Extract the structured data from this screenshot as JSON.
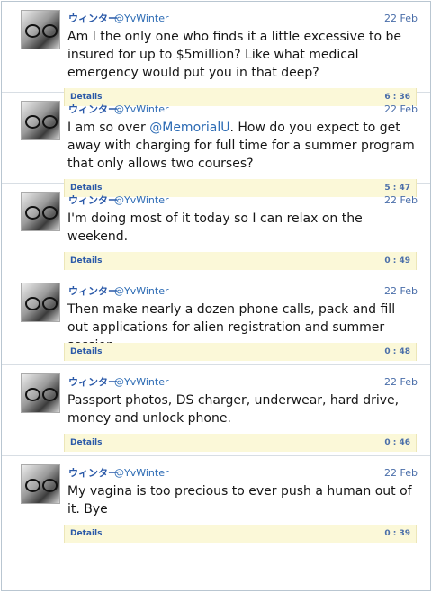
{
  "tweets": [
    {
      "name": "ウィンター",
      "handle": "@YvWinter",
      "date": "22 Feb",
      "text": "Am I the only one who finds it a little excessive to be insured for up to $5million? Like what medical emergency would put you in that deep?",
      "details_label": "Details",
      "time": "6 : 36"
    },
    {
      "name": "ウィンター",
      "handle": "@YvWinter",
      "date": "22 Feb",
      "text_before": "I am so over ",
      "mention": "@MemorialU",
      "text_after": ". How do you expect to get away with charging for full time for a summer program that only allows two courses?",
      "details_label": "Details",
      "time": "5 : 47"
    },
    {
      "name": "ウィンター",
      "handle": "@YvWinter",
      "date": "22 Feb",
      "text": "I'm doing most of it today so I can relax on the weekend.",
      "details_label": "Details",
      "time": "0 : 49"
    },
    {
      "name": "ウィンター",
      "handle": "@YvWinter",
      "date": "22 Feb",
      "text": "Then make nearly a dozen phone calls, pack and fill out applications for alien registration and summer session.",
      "details_label": "Details",
      "time": "0 : 48"
    },
    {
      "name": "ウィンター",
      "handle": "@YvWinter",
      "date": "22 Feb",
      "text": "Passport photos, DS charger, underwear, hard drive, money and unlock phone.",
      "details_label": "Details",
      "time": "0 : 46"
    },
    {
      "name": "ウィンター",
      "handle": "@YvWinter",
      "date": "22 Feb",
      "text": "My vagina is too precious to ever push a human out of it. Bye",
      "details_label": "Details",
      "time": "0 : 39"
    }
  ]
}
